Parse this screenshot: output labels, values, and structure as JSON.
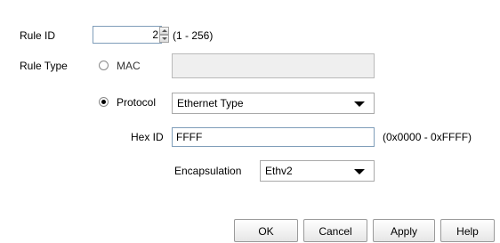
{
  "rule_id": {
    "label": "Rule ID",
    "value": "2",
    "range": "(1 - 256)"
  },
  "rule_type": {
    "label": "Rule Type",
    "mac_label": "MAC",
    "mac_value": "",
    "protocol_label": "Protocol",
    "selected": "Protocol",
    "protocol_select": "Ethernet Type"
  },
  "hex_id": {
    "label": "Hex ID",
    "value": "FFFF",
    "range": "(0x0000 - 0xFFFF)"
  },
  "encapsulation": {
    "label": "Encapsulation",
    "value": "Ethv2"
  },
  "buttons": {
    "ok": "OK",
    "cancel": "Cancel",
    "apply": "Apply",
    "help": "Help"
  }
}
